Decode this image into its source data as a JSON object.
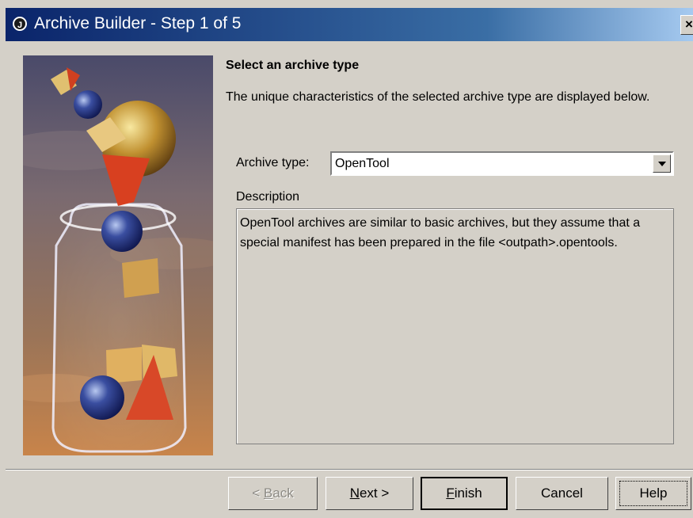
{
  "window": {
    "title": "Archive Builder - Step 1 of 5",
    "app_icon_glyph": "J",
    "close_glyph": "×"
  },
  "content": {
    "heading": "Select an archive type",
    "intro": "The unique characteristics of the selected archive type are displayed below.",
    "archive_type_label": "Archive type:",
    "archive_type_value": "OpenTool",
    "description_label": "Description",
    "description_text": "OpenTool archives are similar to basic archives, but they assume that a special manifest has been prepared in the file <outpath>.opentools."
  },
  "buttons": {
    "back": {
      "before": "< ",
      "mnemonic": "B",
      "after": "ack",
      "disabled": true
    },
    "next": {
      "before": "",
      "mnemonic": "N",
      "after": "ext >"
    },
    "finish": {
      "before": "",
      "mnemonic": "F",
      "after": "inish"
    },
    "cancel": {
      "label": "Cancel"
    },
    "help": {
      "label": "Help"
    }
  },
  "colors": {
    "titlebar_start": "#0a246a",
    "titlebar_end": "#a6caf0",
    "dialog_bg": "#d4d0c8"
  }
}
